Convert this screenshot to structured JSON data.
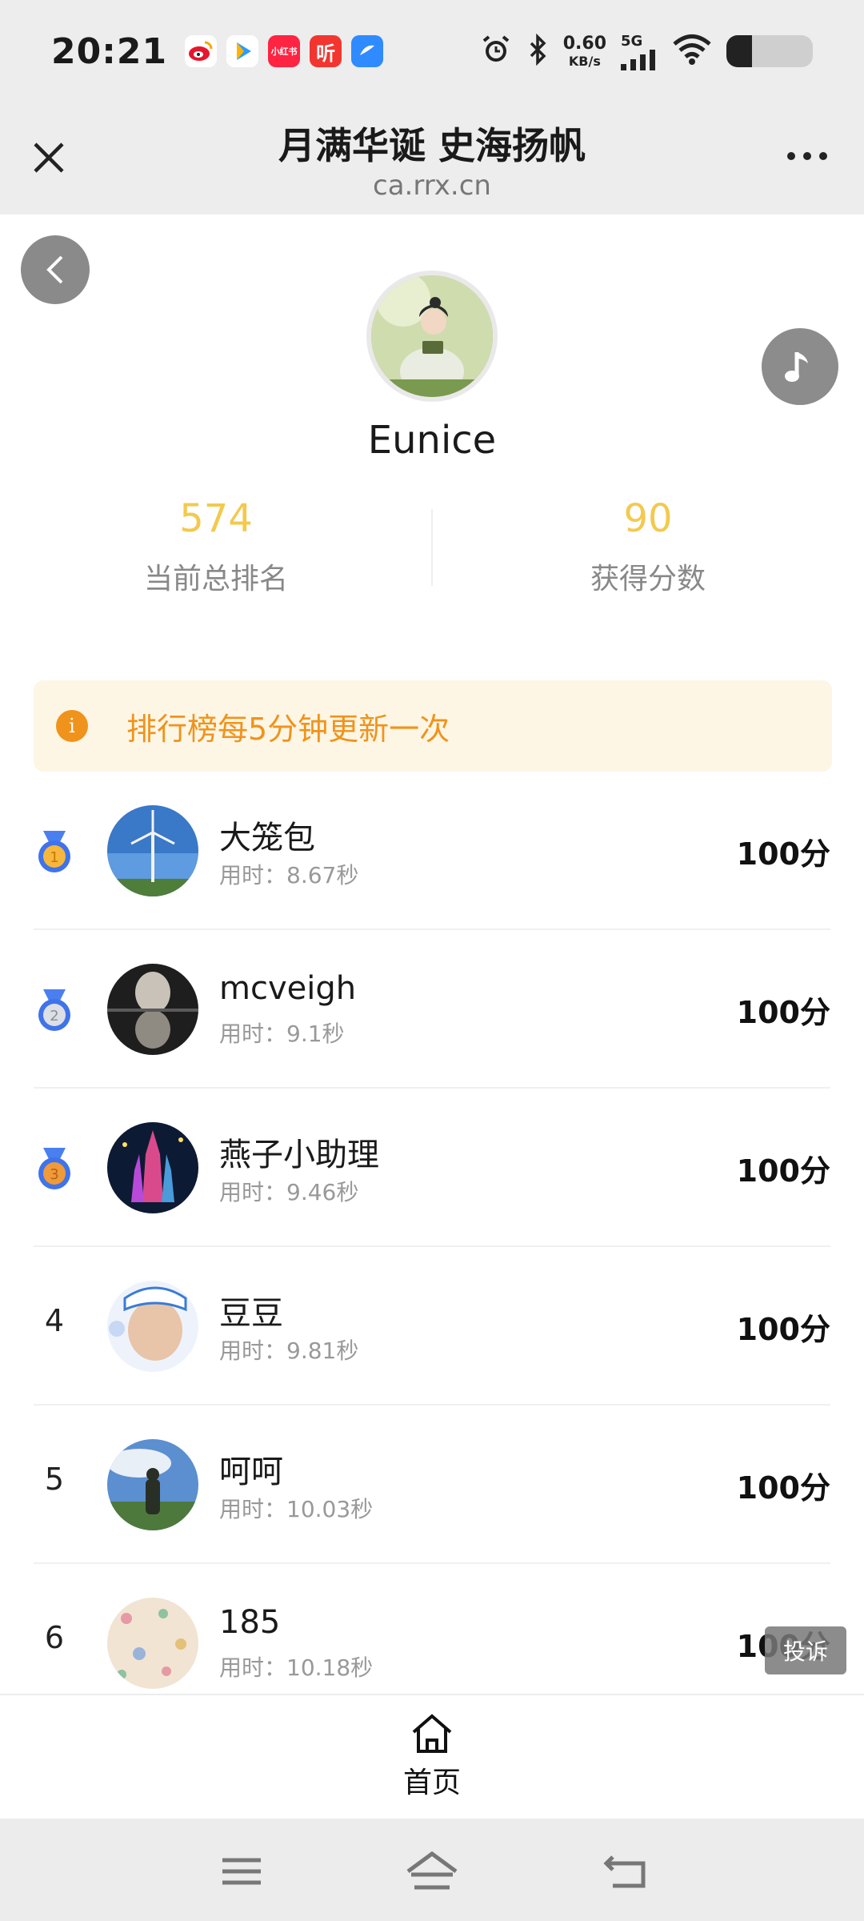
{
  "status_bar": {
    "time": "20:21",
    "apps": [
      {
        "icon": "weibo-icon",
        "color": "#f7c300"
      },
      {
        "icon": "video-app-icon",
        "color": "#ffffff"
      },
      {
        "icon": "xiaohongshu-icon",
        "label": "小红书",
        "color": "#ff2442"
      },
      {
        "icon": "ting-app-icon",
        "label": "听",
        "color": "#f2362f"
      },
      {
        "icon": "browser-app-icon",
        "color": "#2f8bff"
      }
    ],
    "net_speed": "0.60",
    "net_unit": "KB/s",
    "signal_label": "5G",
    "battery_level": 0.3
  },
  "navbar": {
    "title": "月满华诞 史海扬帆",
    "url": "ca.rrx.cn"
  },
  "profile": {
    "name": "Eunice",
    "rank_value": "574",
    "rank_label": "当前总排名",
    "score_value": "90",
    "score_label": "获得分数"
  },
  "notice": {
    "icon_text": "i",
    "text": "排行榜每5分钟更新一次"
  },
  "ranking": [
    {
      "rank": "1",
      "medal": "gold",
      "name": "大笼包",
      "time": "用时：8.67秒",
      "score": "100分"
    },
    {
      "rank": "2",
      "medal": "silver",
      "name": "mcveigh",
      "time": "用时：9.1秒",
      "score": "100分"
    },
    {
      "rank": "3",
      "medal": "bronze",
      "name": "燕子小助理",
      "time": "用时：9.46秒",
      "score": "100分"
    },
    {
      "rank": "4",
      "medal": "",
      "name": "豆豆",
      "time": "用时：9.81秒",
      "score": "100分"
    },
    {
      "rank": "5",
      "medal": "",
      "name": "呵呵",
      "time": "用时：10.03秒",
      "score": "100分"
    },
    {
      "rank": "6",
      "medal": "",
      "name": "185",
      "time": "用时：10.18秒",
      "score": "100分"
    }
  ],
  "complaint_label": "投诉",
  "tabbar": {
    "home_label": "首页"
  },
  "colors": {
    "accent_yellow": "#f3c94e",
    "notice_orange": "#f0931c",
    "notice_bg": "#fdf6e5"
  }
}
